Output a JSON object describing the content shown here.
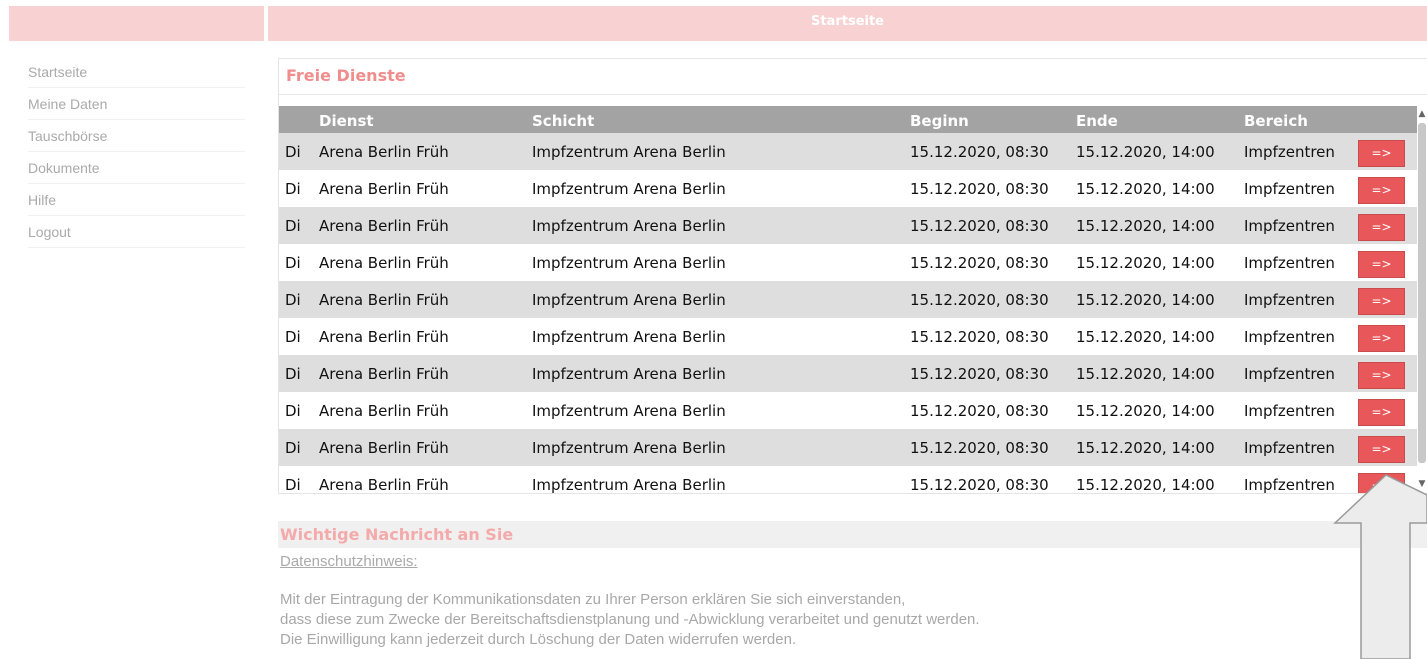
{
  "header": {
    "title": "Startseite"
  },
  "sidebar": {
    "items": [
      {
        "label": "Startseite"
      },
      {
        "label": "Meine Daten"
      },
      {
        "label": "Tauschbörse"
      },
      {
        "label": "Dokumente"
      },
      {
        "label": "Hilfe"
      },
      {
        "label": "Logout"
      }
    ]
  },
  "freie_dienste": {
    "title": "Freie Dienste",
    "columns": [
      "",
      "Dienst",
      "Schicht",
      "Beginn",
      "Ende",
      "Bereich",
      ""
    ],
    "button_label": "=>",
    "rows": [
      {
        "day": "Di",
        "dienst": "Arena Berlin Früh",
        "schicht": "Impfzentrum Arena Berlin",
        "beginn": "15.12.2020, 08:30",
        "ende": "15.12.2020, 14:00",
        "bereich": "Impfzentren"
      },
      {
        "day": "Di",
        "dienst": "Arena Berlin Früh",
        "schicht": "Impfzentrum Arena Berlin",
        "beginn": "15.12.2020, 08:30",
        "ende": "15.12.2020, 14:00",
        "bereich": "Impfzentren"
      },
      {
        "day": "Di",
        "dienst": "Arena Berlin Früh",
        "schicht": "Impfzentrum Arena Berlin",
        "beginn": "15.12.2020, 08:30",
        "ende": "15.12.2020, 14:00",
        "bereich": "Impfzentren"
      },
      {
        "day": "Di",
        "dienst": "Arena Berlin Früh",
        "schicht": "Impfzentrum Arena Berlin",
        "beginn": "15.12.2020, 08:30",
        "ende": "15.12.2020, 14:00",
        "bereich": "Impfzentren"
      },
      {
        "day": "Di",
        "dienst": "Arena Berlin Früh",
        "schicht": "Impfzentrum Arena Berlin",
        "beginn": "15.12.2020, 08:30",
        "ende": "15.12.2020, 14:00",
        "bereich": "Impfzentren"
      },
      {
        "day": "Di",
        "dienst": "Arena Berlin Früh",
        "schicht": "Impfzentrum Arena Berlin",
        "beginn": "15.12.2020, 08:30",
        "ende": "15.12.2020, 14:00",
        "bereich": "Impfzentren"
      },
      {
        "day": "Di",
        "dienst": "Arena Berlin Früh",
        "schicht": "Impfzentrum Arena Berlin",
        "beginn": "15.12.2020, 08:30",
        "ende": "15.12.2020, 14:00",
        "bereich": "Impfzentren"
      },
      {
        "day": "Di",
        "dienst": "Arena Berlin Früh",
        "schicht": "Impfzentrum Arena Berlin",
        "beginn": "15.12.2020, 08:30",
        "ende": "15.12.2020, 14:00",
        "bereich": "Impfzentren"
      },
      {
        "day": "Di",
        "dienst": "Arena Berlin Früh",
        "schicht": "Impfzentrum Arena Berlin",
        "beginn": "15.12.2020, 08:30",
        "ende": "15.12.2020, 14:00",
        "bereich": "Impfzentren"
      },
      {
        "day": "Di",
        "dienst": "Arena Berlin Früh",
        "schicht": "Impfzentrum Arena Berlin",
        "beginn": "15.12.2020, 08:30",
        "ende": "15.12.2020, 14:00",
        "bereich": "Impfzentren"
      }
    ]
  },
  "message": {
    "title": "Wichtige Nachricht an Sie",
    "link": "Datenschutzhinweis:",
    "lines": [
      "Mit der Eintragung der Kommunikationsdaten zu Ihrer Person erklären Sie sich einverstanden,",
      "dass diese zum Zwecke der Bereitschaftsdienstplanung und -Abwicklung verarbeitet und genutzt werden.",
      "Die Einwilligung kann jederzeit durch Löschung der Daten widerrufen werden."
    ]
  },
  "colors": {
    "header_bg": "#f8d2d2",
    "accent_title": "#f08e8e",
    "table_header_bg": "#a3a3a3",
    "row_alt_bg": "#dedede",
    "button_bg": "#e8585a",
    "muted_text": "#aaaaaa"
  }
}
